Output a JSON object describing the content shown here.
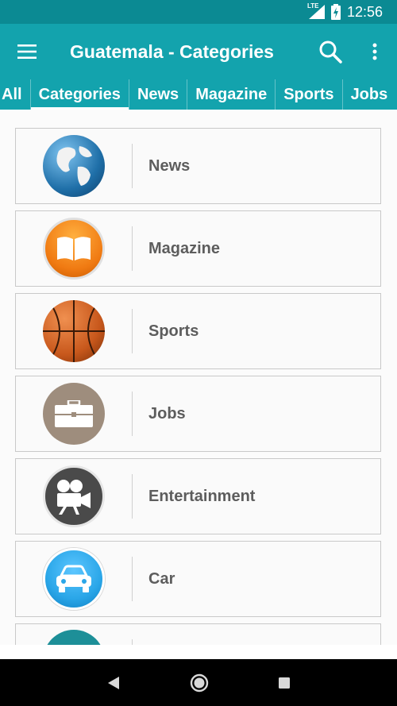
{
  "status": {
    "network": "LTE",
    "time": "12:56"
  },
  "app_bar": {
    "title": "Guatemala - Categories"
  },
  "tabs": [
    "All",
    "Categories",
    "News",
    "Magazine",
    "Sports",
    "Jobs"
  ],
  "active_tab": "Categories",
  "categories": [
    {
      "label": "News",
      "icon": "globe-icon",
      "color": "#1f6fa8"
    },
    {
      "label": "Magazine",
      "icon": "book-icon",
      "color": "#f07a12"
    },
    {
      "label": "Sports",
      "icon": "basketball-icon",
      "color": "#c8581c"
    },
    {
      "label": "Jobs",
      "icon": "briefcase-icon",
      "color": "#9e8d7d"
    },
    {
      "label": "Entertainment",
      "icon": "video-camera-icon",
      "color": "#4a4a4a"
    },
    {
      "label": "Car",
      "icon": "car-icon",
      "color": "#2aa6e8"
    },
    {
      "label": "",
      "icon": "category-icon",
      "color": "#1d8f98"
    }
  ],
  "colors": {
    "status_bar": "#0b8a93",
    "app_bar": "#13a3ad",
    "label_text": "#5d5d5d"
  }
}
